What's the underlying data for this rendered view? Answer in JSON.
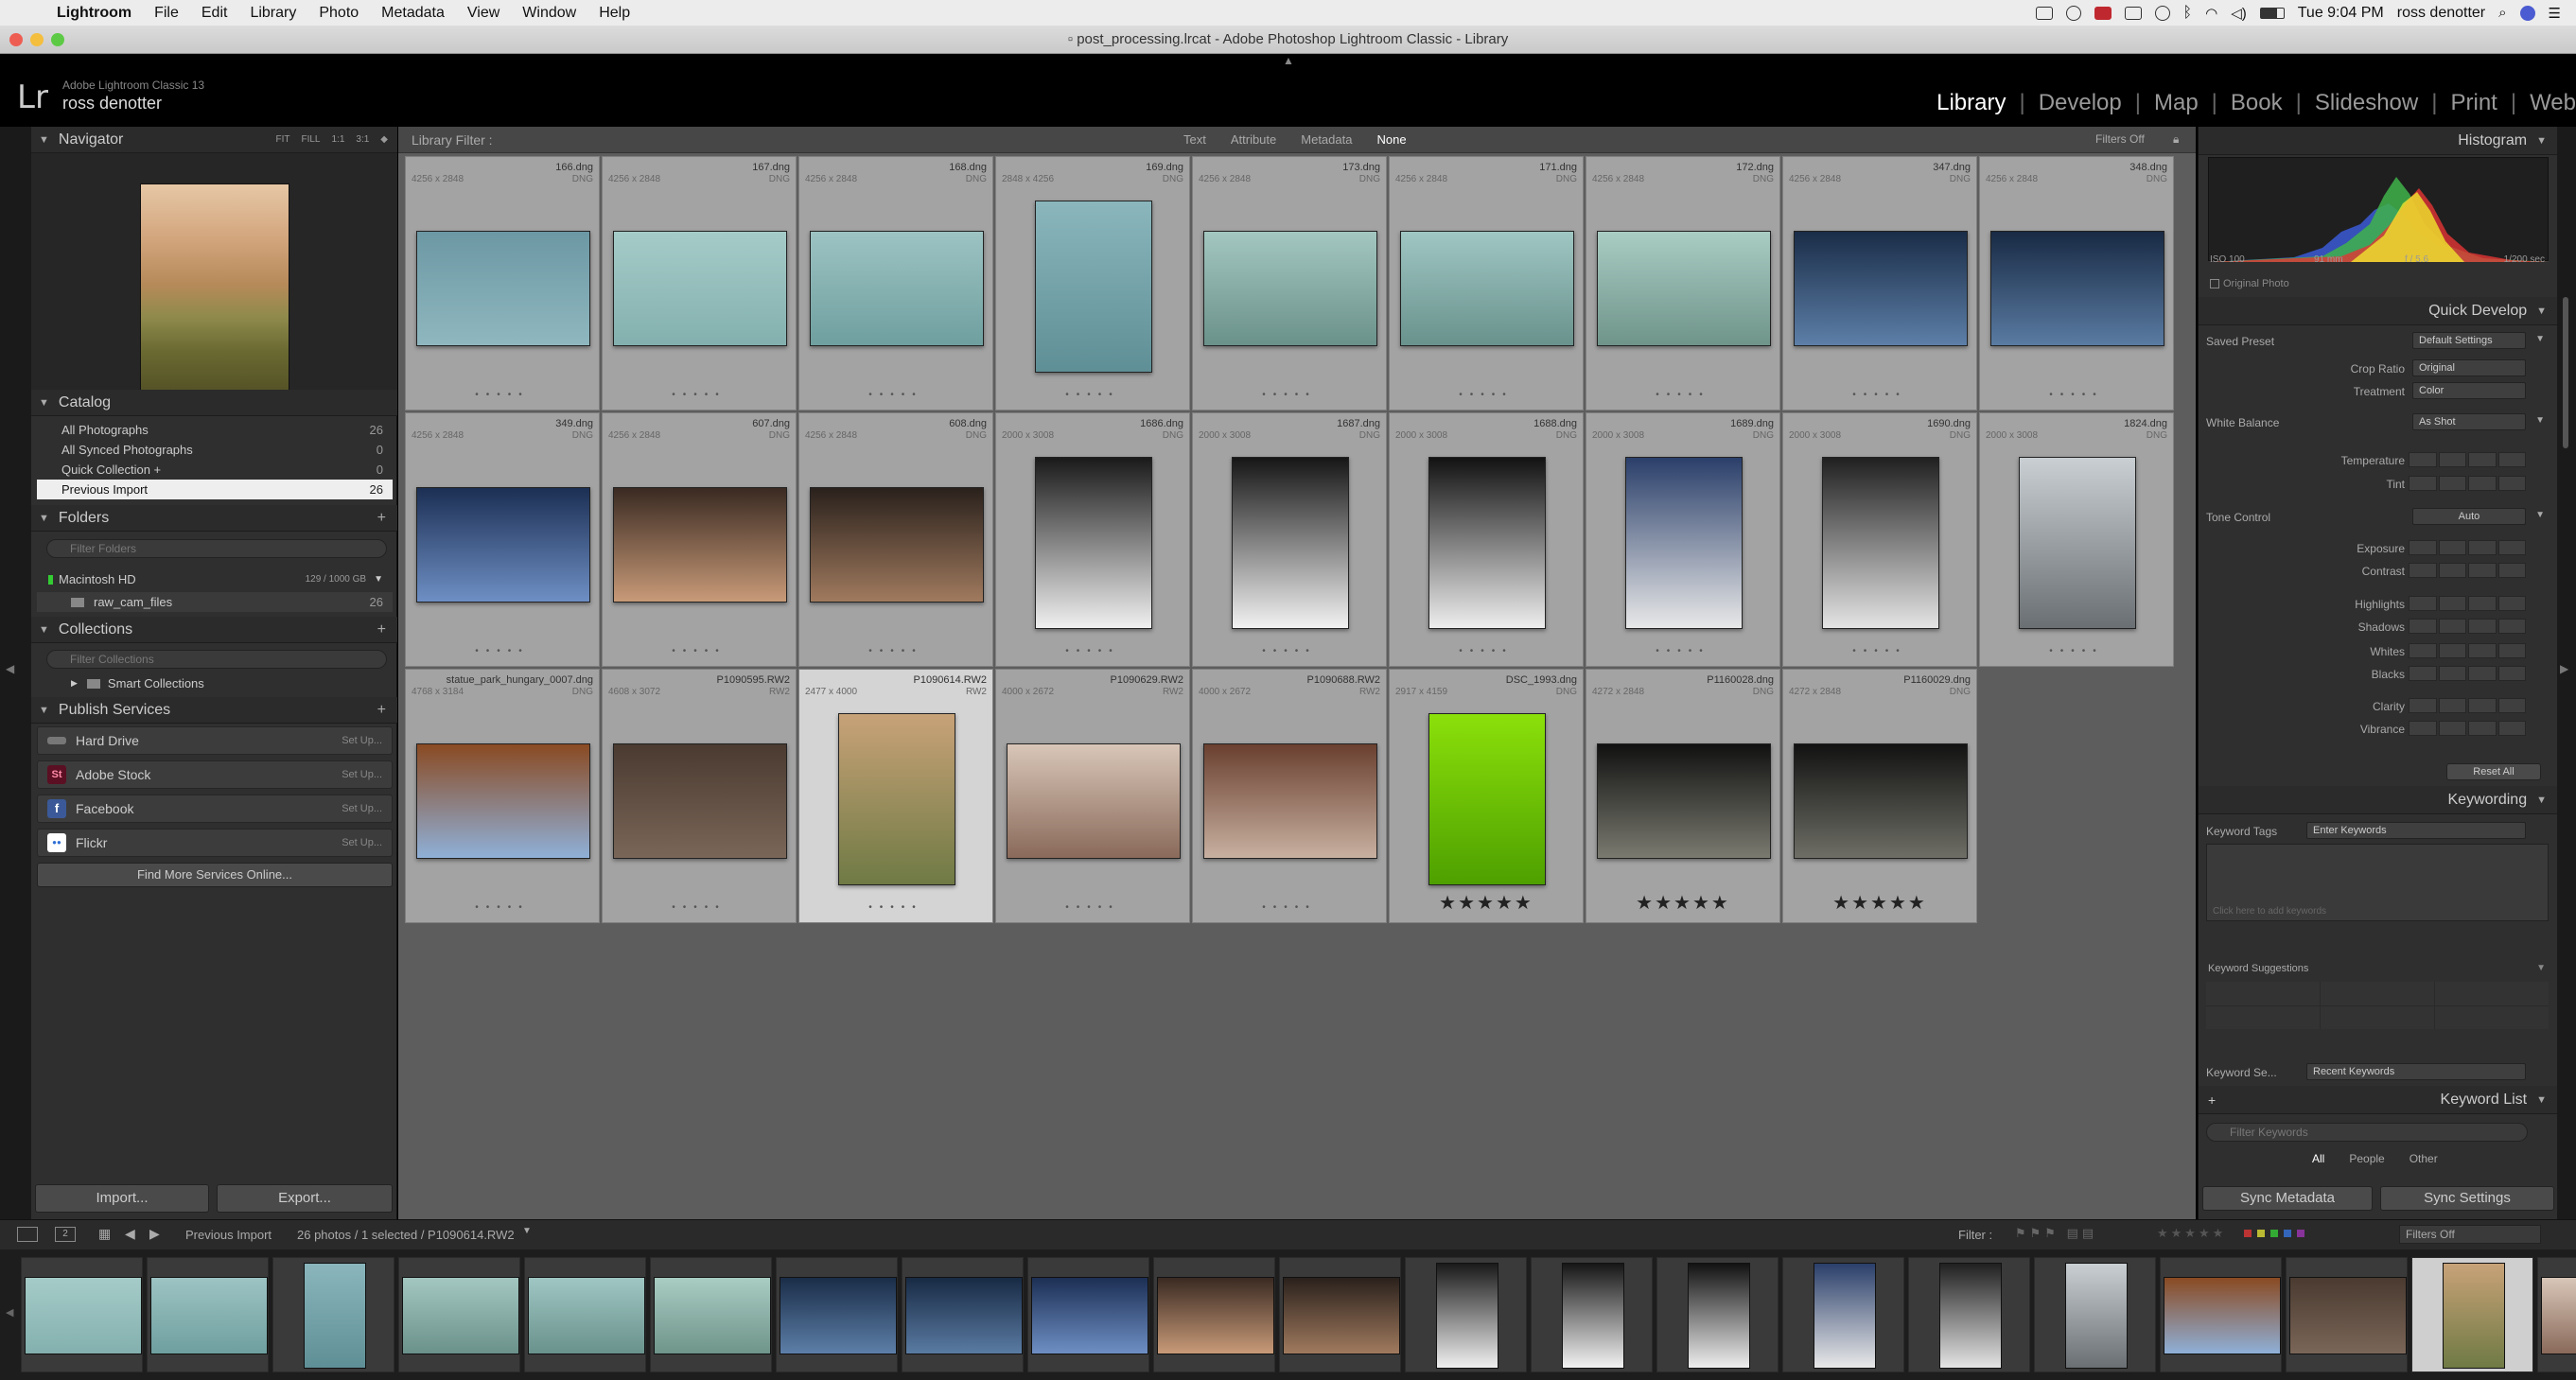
{
  "menubar": {
    "app": "Lightroom",
    "items": [
      "File",
      "Edit",
      "Library",
      "Photo",
      "Metadata",
      "View",
      "Window",
      "Help"
    ],
    "clock": "Tue 9:04 PM",
    "user": "ross denotter"
  },
  "window": {
    "title": "post_processing.lrcat - Adobe Photoshop Lightroom Classic - Library"
  },
  "identity": {
    "product": "Adobe Lightroom Classic 13",
    "user": "ross denotter"
  },
  "modules": [
    "Library",
    "Develop",
    "Map",
    "Book",
    "Slideshow",
    "Print",
    "Web"
  ],
  "active_module": "Library",
  "left": {
    "navigator": {
      "title": "Navigator",
      "zoom": [
        "FIT",
        "FILL",
        "1:1",
        "3:1"
      ]
    },
    "catalog": {
      "title": "Catalog",
      "items": [
        {
          "label": "All Photographs",
          "count": "26"
        },
        {
          "label": "All Synced Photographs",
          "count": "0"
        },
        {
          "label": "Quick Collection +",
          "count": "0"
        },
        {
          "label": "Previous Import",
          "count": "26"
        }
      ]
    },
    "folders": {
      "title": "Folders",
      "filter_placeholder": "Filter Folders",
      "volume": "Macintosh HD",
      "volume_space": "129 / 1000 GB",
      "folder": "raw_cam_files",
      "folder_count": "26"
    },
    "collections": {
      "title": "Collections",
      "filter_placeholder": "Filter Collections",
      "smart": "Smart Collections"
    },
    "publish": {
      "title": "Publish Services",
      "services": [
        {
          "name": "Hard Drive",
          "action": "Set Up...",
          "icon": "hard-drive-icon",
          "color": "#777777",
          "glyph": "▬"
        },
        {
          "name": "Adobe Stock",
          "action": "Set Up...",
          "icon": "adobe-stock-icon",
          "color": "#cc2a52",
          "glyph": "St"
        },
        {
          "name": "Facebook",
          "action": "Set Up...",
          "icon": "facebook-icon",
          "color": "#3b5998",
          "glyph": "f"
        },
        {
          "name": "Flickr",
          "action": "Set Up...",
          "icon": "flickr-icon",
          "color": "#2f6fd6",
          "glyph": "●●"
        }
      ],
      "find_more": "Find More Services Online..."
    },
    "import": "Import...",
    "export": "Export..."
  },
  "filterbar": {
    "title": "Library Filter :",
    "opts": [
      "Text",
      "Attribute",
      "Metadata",
      "None"
    ],
    "active": "None",
    "filters_off": "Filters Off"
  },
  "grid": [
    {
      "name": "166.dng",
      "dim": "4256 x 2848",
      "ext": "DNG",
      "stars": "",
      "colors": [
        "#6c98a4",
        "#8fb7bf"
      ],
      "orient": "l"
    },
    {
      "name": "167.dng",
      "dim": "4256 x 2848",
      "ext": "DNG",
      "stars": "",
      "colors": [
        "#a5cbc8",
        "#83b0ae"
      ],
      "orient": "l"
    },
    {
      "name": "168.dng",
      "dim": "4256 x 2848",
      "ext": "DNG",
      "stars": "",
      "colors": [
        "#9dc3c3",
        "#6f9f9f"
      ],
      "orient": "l"
    },
    {
      "name": "169.dng",
      "dim": "2848 x 4256",
      "ext": "DNG",
      "stars": "",
      "colors": [
        "#8ab6bc",
        "#5f8f96"
      ],
      "orient": "p"
    },
    {
      "name": "173.dng",
      "dim": "4256 x 2848",
      "ext": "DNG",
      "stars": "",
      "colors": [
        "#a3c7c0",
        "#6b918b"
      ],
      "orient": "l"
    },
    {
      "name": "171.dng",
      "dim": "4256 x 2848",
      "ext": "DNG",
      "stars": "",
      "colors": [
        "#9fc6c2",
        "#6a928d"
      ],
      "orient": "l"
    },
    {
      "name": "172.dng",
      "dim": "4256 x 2848",
      "ext": "DNG",
      "stars": "",
      "colors": [
        "#a9ccc3",
        "#6f948a"
      ],
      "orient": "l"
    },
    {
      "name": "347.dng",
      "dim": "4256 x 2848",
      "ext": "DNG",
      "stars": "",
      "colors": [
        "#1a2d48",
        "#5d7fa8"
      ],
      "orient": "l"
    },
    {
      "name": "348.dng",
      "dim": "4256 x 2848",
      "ext": "DNG",
      "stars": "",
      "colors": [
        "#182a44",
        "#5a7ba2"
      ],
      "orient": "l"
    },
    {
      "name": "349.dng",
      "dim": "4256 x 2848",
      "ext": "DNG",
      "stars": "",
      "colors": [
        "#1c2f54",
        "#6e8fc4"
      ],
      "orient": "l"
    },
    {
      "name": "607.dng",
      "dim": "4256 x 2848",
      "ext": "DNG",
      "stars": "",
      "colors": [
        "#3a2a22",
        "#c89a78"
      ],
      "orient": "l"
    },
    {
      "name": "608.dng",
      "dim": "4256 x 2848",
      "ext": "DNG",
      "stars": "",
      "colors": [
        "#2a211c",
        "#a07a5e"
      ],
      "orient": "l"
    },
    {
      "name": "1686.dng",
      "dim": "2000 x 3008",
      "ext": "DNG",
      "stars": "",
      "colors": [
        "#1a1a1a",
        "#f0f0f0"
      ],
      "orient": "p"
    },
    {
      "name": "1687.dng",
      "dim": "2000 x 3008",
      "ext": "DNG",
      "stars": "",
      "colors": [
        "#161616",
        "#f2f2f2"
      ],
      "orient": "p"
    },
    {
      "name": "1688.dng",
      "dim": "2000 x 3008",
      "ext": "DNG",
      "stars": "",
      "colors": [
        "#121212",
        "#eeeeee"
      ],
      "orient": "p"
    },
    {
      "name": "1689.dng",
      "dim": "2000 x 3008",
      "ext": "DNG",
      "stars": "",
      "colors": [
        "#2a3f6a",
        "#e8e8e8"
      ],
      "orient": "p"
    },
    {
      "name": "1690.dng",
      "dim": "2000 x 3008",
      "ext": "DNG",
      "stars": "",
      "colors": [
        "#202020",
        "#e4e4e4"
      ],
      "orient": "p"
    },
    {
      "name": "1824.dng",
      "dim": "2000 x 3008",
      "ext": "DNG",
      "stars": "",
      "colors": [
        "#c9cfd3",
        "#6a6f73"
      ],
      "orient": "p"
    },
    {
      "name": "statue_park_hungary_0007.dng",
      "dim": "4768 x 3184",
      "ext": "DNG",
      "stars": "",
      "colors": [
        "#8a4a22",
        "#8fb0d8"
      ],
      "orient": "l"
    },
    {
      "name": "P1090595.RW2",
      "dim": "4608 x 3072",
      "ext": "RW2",
      "stars": "",
      "colors": [
        "#4a3a30",
        "#7a6658"
      ],
      "orient": "l"
    },
    {
      "name": "P1090614.RW2",
      "dim": "2477 x 4000",
      "ext": "RW2",
      "stars": "",
      "colors": [
        "#c8a278",
        "#6f7a44"
      ],
      "orient": "p",
      "selected": true
    },
    {
      "name": "P1090629.RW2",
      "dim": "4000 x 2672",
      "ext": "RW2",
      "stars": "",
      "colors": [
        "#d8c6b8",
        "#8a6a5a"
      ],
      "orient": "l"
    },
    {
      "name": "P1090688.RW2",
      "dim": "4000 x 2672",
      "ext": "RW2",
      "stars": "",
      "colors": [
        "#6a4030",
        "#c8b0a0"
      ],
      "orient": "l"
    },
    {
      "name": "DSC_1993.dng",
      "dim": "2917 x 4159",
      "ext": "DNG",
      "stars": "★★★★★",
      "colors": [
        "#8be00a",
        "#4ea000"
      ],
      "orient": "p"
    },
    {
      "name": "P1160028.dng",
      "dim": "4272 x 2848",
      "ext": "DNG",
      "stars": "★★★★★",
      "colors": [
        "#111111",
        "#7a7a70"
      ],
      "orient": "l"
    },
    {
      "name": "P1160029.dng",
      "dim": "4272 x 2848",
      "ext": "DNG",
      "stars": "★★★★★",
      "colors": [
        "#121212",
        "#6e6e66"
      ],
      "orient": "l"
    }
  ],
  "right": {
    "histogram": {
      "title": "Histogram",
      "iso": "ISO 100",
      "focal": "91 mm",
      "aperture": "f / 5.6",
      "shutter": "1/200 sec",
      "original": "Original Photo"
    },
    "quick_develop": {
      "title": "Quick Develop",
      "saved_preset": "Saved Preset",
      "saved_preset_value": "Default Settings",
      "crop": "Crop Ratio",
      "crop_value": "Original",
      "treatment": "Treatment",
      "treatment_value": "Color",
      "wb": "White Balance",
      "wb_value": "As Shot",
      "wb_rows": [
        "Temperature",
        "Tint"
      ],
      "tone": "Tone Control",
      "auto": "Auto",
      "tone_rows": [
        "Exposure",
        "Contrast",
        "Highlights",
        "Shadows",
        "Whites",
        "Blacks",
        "Clarity",
        "Vibrance"
      ],
      "reset": "Reset All"
    },
    "keywording": {
      "title": "Keywording",
      "tags_label": "Keyword Tags",
      "tags_value": "Enter Keywords",
      "hint": "Click here to add keywords",
      "suggestions": "Keyword Suggestions",
      "set_label": "Keyword Se...",
      "set_value": "Recent Keywords"
    },
    "keyword_list": {
      "title": "Keyword List",
      "filter_placeholder": "Filter Keywords",
      "tabs": [
        "All",
        "People",
        "Other"
      ]
    },
    "sync_metadata": "Sync Metadata",
    "sync_settings": "Sync Settings"
  },
  "toolbar": {
    "source": "Previous Import",
    "info": "26 photos / 1 selected / P1090614.RW2",
    "filter": "Filter :",
    "filters_off": "Filters Off"
  }
}
